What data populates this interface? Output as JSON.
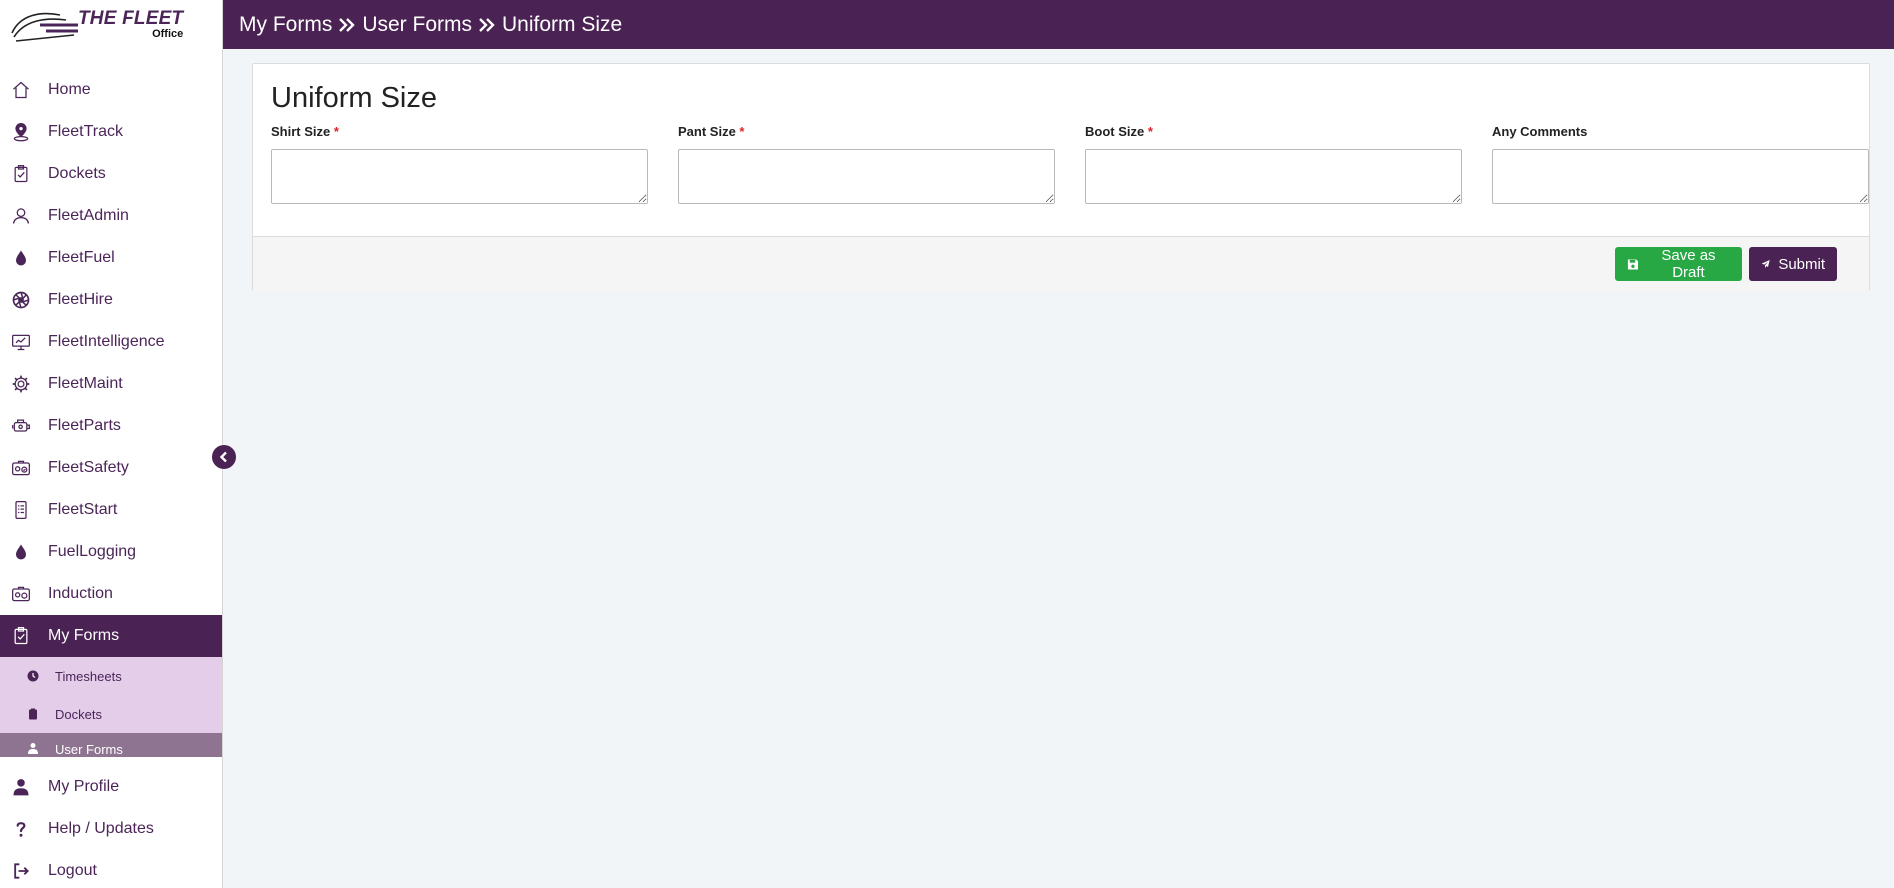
{
  "logo": {
    "main": "THE FLEET",
    "sub": "Office"
  },
  "breadcrumb": [
    "My Forms",
    "User Forms",
    "Uniform Size"
  ],
  "sidebar": {
    "items": [
      {
        "label": "Home",
        "icon": "home-icon"
      },
      {
        "label": "FleetTrack",
        "icon": "map-pin-icon"
      },
      {
        "label": "Dockets",
        "icon": "clipboard-check-icon"
      },
      {
        "label": "FleetAdmin",
        "icon": "user-icon"
      },
      {
        "label": "FleetFuel",
        "icon": "drop-icon"
      },
      {
        "label": "FleetHire",
        "icon": "aperture-icon"
      },
      {
        "label": "FleetIntelligence",
        "icon": "monitor-chart-icon"
      },
      {
        "label": "FleetMaint",
        "icon": "gear-icon"
      },
      {
        "label": "FleetParts",
        "icon": "engine-icon"
      },
      {
        "label": "FleetSafety",
        "icon": "badge-check-icon"
      },
      {
        "label": "FleetStart",
        "icon": "phone-checklist-icon"
      },
      {
        "label": "FuelLogging",
        "icon": "drop-icon"
      },
      {
        "label": "Induction",
        "icon": "id-card-icon"
      },
      {
        "label": "My Forms",
        "icon": "clipboard-check-icon",
        "active": true
      }
    ],
    "sub_items": [
      {
        "label": "Timesheets",
        "icon": "clock-icon"
      },
      {
        "label": "Dockets",
        "icon": "clipboard-icon"
      },
      {
        "label": "User Forms",
        "icon": "person-icon",
        "active": true
      }
    ],
    "bottom_items": [
      {
        "label": "My Profile",
        "icon": "person-icon"
      },
      {
        "label": "Help / Updates",
        "icon": "question-icon"
      },
      {
        "label": "Logout",
        "icon": "logout-icon"
      }
    ]
  },
  "form": {
    "title": "Uniform Size",
    "required_mark": "*",
    "fields": [
      {
        "label": "Shirt Size",
        "required": true,
        "value": ""
      },
      {
        "label": "Pant Size",
        "required": true,
        "value": ""
      },
      {
        "label": "Boot Size",
        "required": true,
        "value": ""
      },
      {
        "label": "Any Comments",
        "required": false,
        "value": ""
      }
    ]
  },
  "buttons": {
    "draft": "Save as Draft",
    "submit": "Submit"
  },
  "colors": {
    "brand": "#4a2253",
    "submenu_bg": "#e3cde9",
    "submenu_active": "#8f7491",
    "draft_green": "#28a745",
    "required_red": "#e0212e"
  }
}
